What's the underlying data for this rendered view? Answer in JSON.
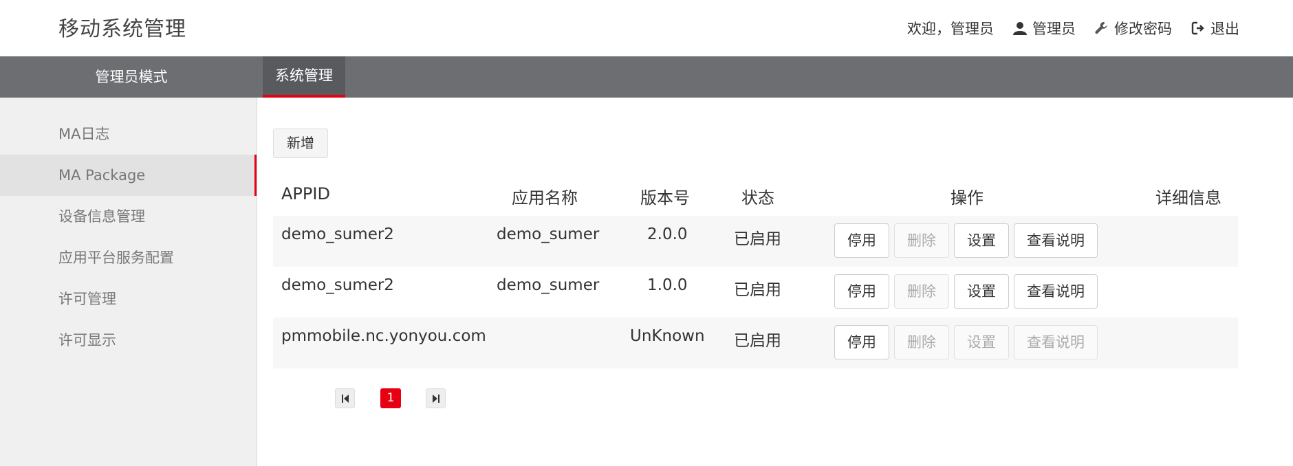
{
  "header": {
    "title": "移动系统管理",
    "welcome": "欢迎，管理员",
    "user": "管理员",
    "change_password": "修改密码",
    "logout": "退出"
  },
  "nav": {
    "mode": "管理员模式",
    "active_tab": "系统管理"
  },
  "sidebar": {
    "items": [
      {
        "label": "MA日志"
      },
      {
        "label": "MA Package"
      },
      {
        "label": "设备信息管理"
      },
      {
        "label": "应用平台服务配置"
      },
      {
        "label": "许可管理"
      },
      {
        "label": "许可显示"
      }
    ],
    "active_index": 1
  },
  "toolbar": {
    "add_label": "新增"
  },
  "table": {
    "headers": {
      "appid": "APPID",
      "name": "应用名称",
      "version": "版本号",
      "status": "状态",
      "actions": "操作",
      "details": "详细信息"
    },
    "rows": [
      {
        "appid": "demo_sumer2",
        "name": "demo_sumer",
        "version": "2.0.0",
        "status": "已启用",
        "disable": "停用",
        "delete": "删除",
        "settings": "设置",
        "readme": "查看说明"
      },
      {
        "appid": "demo_sumer2",
        "name": "demo_sumer",
        "version": "1.0.0",
        "status": "已启用",
        "disable": "停用",
        "delete": "删除",
        "settings": "设置",
        "readme": "查看说明"
      },
      {
        "appid": "pmmobile.nc.yonyou.com",
        "name": "",
        "version": "UnKnown",
        "status": "已启用",
        "disable": "停用",
        "delete": "删除",
        "settings": "设置",
        "readme": "查看说明"
      }
    ]
  },
  "pagination": {
    "current_page": "1"
  },
  "colors": {
    "accent": "#e60012",
    "nav_bg": "#6d6e72",
    "sidebar_bg": "#f0f0f0"
  }
}
